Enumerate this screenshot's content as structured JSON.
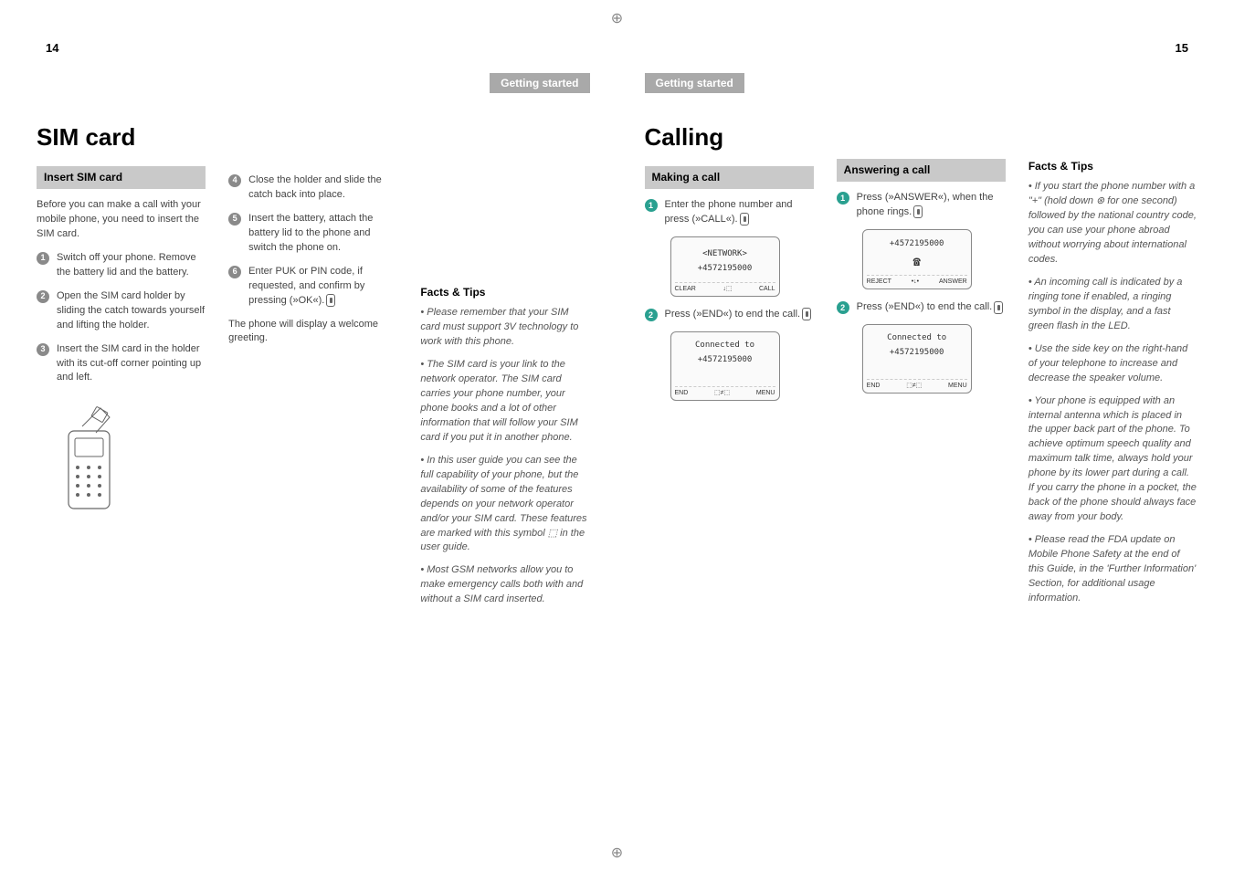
{
  "pageNumbers": {
    "left": "14",
    "right": "15"
  },
  "headerLabel": "Getting started",
  "leftPage": {
    "title": "SIM card",
    "sectionTitle": "Insert SIM card",
    "intro": "Before you can make a call with your mobile phone, you need to insert the SIM card.",
    "steps1": [
      "Switch off your phone. Remove the battery lid and the battery.",
      "Open the SIM card holder by sliding the catch towards yourself and lifting the holder.",
      "Insert the SIM card in the holder with its cut-off corner pointing up and left."
    ],
    "steps2": [
      "Close the holder and slide the catch back into place.",
      "Insert the battery, attach the battery lid to the phone and switch the phone on.",
      "Enter PUK or PIN code, if requested, and confirm by pressing      (»OK«)."
    ],
    "afterSteps": "The phone will display a welcome greeting.",
    "factsTitle": "Facts & Tips",
    "facts": [
      "• Please remember that your SIM card must support 3V technology to work with this phone.",
      "• The SIM card is your link to the network operator. The SIM card carries your phone number, your phone books and a lot of other information that will follow your SIM card if you put it in another phone.",
      "• In this user guide you can see the full capability of your phone, but the availability of some of the features depends on your network operator and/or your SIM card. These features are marked with this symbol  ⬚  in the user guide.",
      "• Most GSM networks allow you to make emergency calls both with and without a SIM card inserted."
    ]
  },
  "rightPage": {
    "title": "Calling",
    "makingTitle": "Making a call",
    "makingSteps": [
      "Enter the phone number and press      (»CALL«).",
      "Press       (»END«) to end the call."
    ],
    "screen1": {
      "line1": "<NETWORK>",
      "line2": "+4572195000",
      "sk": [
        "CLEAR",
        "↓⬚",
        "CALL"
      ]
    },
    "screen2": {
      "line1": "Connected to",
      "line2": "+4572195000",
      "sk": [
        "END",
        "⬚≠⬚",
        "MENU"
      ]
    },
    "answeringTitle": "Answering a call",
    "answeringSteps": [
      "Press      (»ANSWER«), when the phone rings.",
      "Press       (»END«) to end the call."
    ],
    "screen3": {
      "line1": "+4572195000",
      "line2": "☎",
      "sk": [
        "REJECT",
        "•↓•",
        "ANSWER"
      ]
    },
    "screen4": {
      "line1": "Connected to",
      "line2": "+4572195000",
      "sk": [
        "END",
        "⬚≠⬚",
        "MENU"
      ]
    },
    "factsTitle": "Facts & Tips",
    "facts": [
      "• If you start the phone number with a \"+\" (hold down  ⊛  for one second) followed by the national country code, you can use your phone abroad without worrying about international codes.",
      "• An incoming call is indicated by a ringing tone if enabled, a ringing symbol in the display, and a fast green flash in the LED.",
      "• Use the side key on the right-hand of your telephone to increase and decrease the speaker volume.",
      "• Your phone is equipped with an internal antenna which is placed in the upper back part of the phone. To achieve optimum speech quality and maximum talk time, always hold your phone by its lower part during a call. If you carry the phone in a pocket, the back of the phone should always face away from your body.",
      "• Please read the FDA update on Mobile Phone Safety at the end of this Guide, in the 'Further Information' Section, for additional usage information."
    ]
  }
}
